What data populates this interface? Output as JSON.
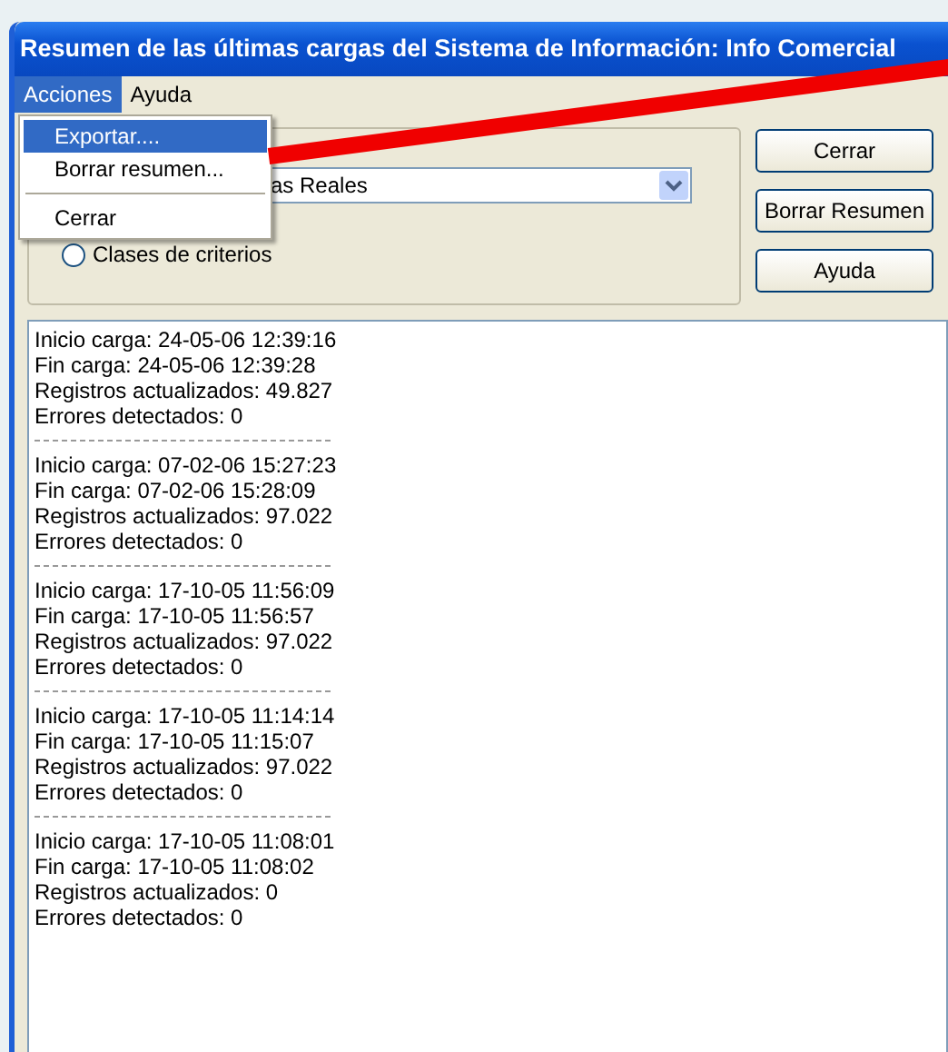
{
  "window": {
    "title": "Resumen de las últimas cargas del Sistema de Información: Info Comercial"
  },
  "menu_bar": [
    {
      "label": "Acciones",
      "selected": true
    },
    {
      "label": "Ayuda",
      "selected": false
    }
  ],
  "open_menu": {
    "items": [
      {
        "kind": "item",
        "label": "Exportar....",
        "selected": true
      },
      {
        "kind": "item",
        "label": "Borrar resumen...",
        "selected": false
      },
      {
        "kind": "separator"
      },
      {
        "kind": "item",
        "label": "Cerrar",
        "selected": false
      }
    ]
  },
  "criteria": {
    "combo_value": "as Reales",
    "radio": {
      "label": "Clases de criterios",
      "checked": false
    }
  },
  "buttons": [
    "Cerrar",
    "Borrar Resumen",
    "Ayuda"
  ],
  "log": [
    {
      "lines": [
        "Inicio carga: 24-05-06  12:39:16",
        "Fin carga: 24-05-06  12:39:28",
        "Registros actualizados: 49.827",
        "Errores detectados: 0"
      ]
    },
    {
      "lines": [
        "Inicio carga: 07-02-06  15:27:23",
        "Fin carga: 07-02-06  15:28:09",
        "Registros actualizados: 97.022",
        "Errores detectados: 0"
      ]
    },
    {
      "lines": [
        "Inicio carga: 17-10-05  11:56:09",
        "Fin carga: 17-10-05  11:56:57",
        "Registros actualizados: 97.022",
        "Errores detectados: 0"
      ]
    },
    {
      "lines": [
        "Inicio carga: 17-10-05  11:14:14",
        "Fin carga: 17-10-05  11:15:07",
        "Registros actualizados: 97.022",
        "Errores detectados: 0"
      ]
    },
    {
      "lines": [
        "Inicio carga: 17-10-05  11:08:01",
        "Fin carga: 17-10-05  11:08:02",
        "Registros actualizados: 0",
        "Errores detectados: 0"
      ]
    }
  ]
}
